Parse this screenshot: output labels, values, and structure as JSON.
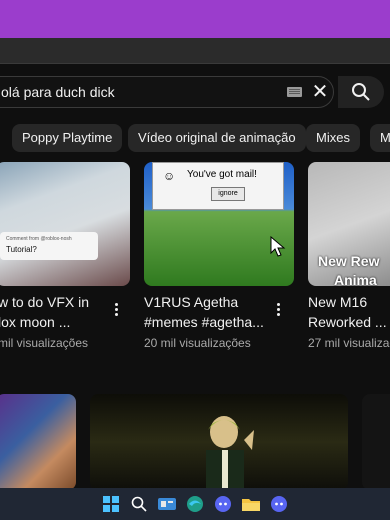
{
  "search": {
    "query": "olá para duch dick"
  },
  "chips": [
    "Poppy Playtime",
    "Vídeo original de animação",
    "Mixes",
    "M"
  ],
  "videos": [
    {
      "title_line1": "w to do VFX in",
      "title_line2": "lox moon ...",
      "views": "mil visualizações",
      "card_small": "Comment from @roblox-nosh",
      "card_text": "Tutorial?"
    },
    {
      "title_line1": "V1RUS Agetha",
      "title_line2": "#memes #agetha...",
      "views": "20 mil visualizações",
      "mail_text": "You've got mail!",
      "mail_button": "ignore"
    },
    {
      "title_line1": "New M16",
      "title_line2": "Reworked ...",
      "views": "27 mil visualizaç",
      "overlay_line1": "New Rew",
      "overlay_line2": "Anima"
    }
  ],
  "colors": {
    "top_band": "#9b3dcc",
    "taskbar": "#202734",
    "background": "#0f0f0f"
  },
  "taskbar_icons": [
    "windows-icon",
    "search-icon",
    "widgets-icon",
    "edge-icon",
    "discord-icon",
    "file-explorer-icon",
    "discord-icon"
  ]
}
